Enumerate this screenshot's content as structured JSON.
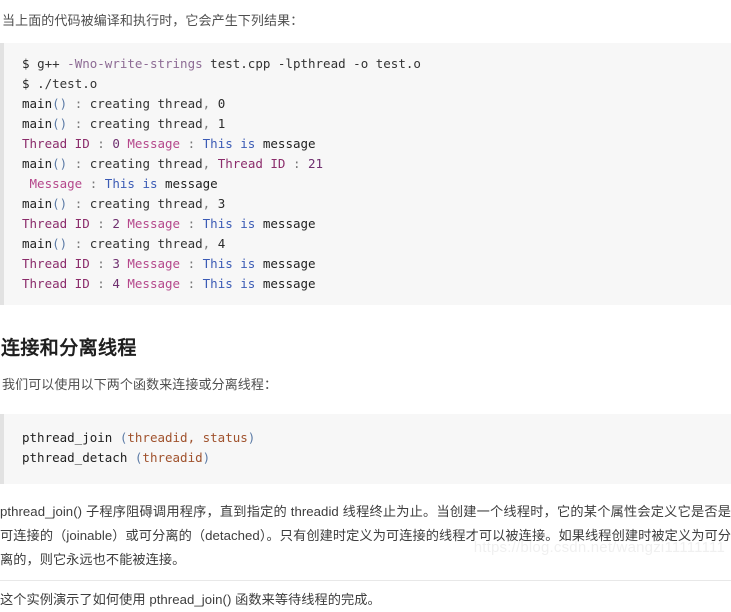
{
  "intro": {
    "paragraph": "当上面的代码被编译和执行时，它会产生下列结果："
  },
  "output_code_block": {
    "lines": [
      {
        "id": "compile",
        "tokens": [
          {
            "text": "$ ",
            "style": "t-dark"
          },
          {
            "text": "g++ ",
            "style": "t-plain"
          },
          {
            "text": "-Wno-write-strings",
            "style": "t-flag"
          },
          {
            "text": " test.cpp ",
            "style": "t-plain"
          },
          {
            "text": "-lpthread",
            "style": "t-plain"
          },
          {
            "text": " -o test.o",
            "style": "t-plain"
          }
        ]
      },
      {
        "id": "run",
        "tokens": [
          {
            "text": "$ ",
            "style": "t-dark"
          },
          {
            "text": "./test.o",
            "style": "t-plain"
          }
        ]
      },
      {
        "id": "main-0",
        "tokens": [
          {
            "text": "main",
            "style": "t-dark"
          },
          {
            "text": "()",
            "style": "t-paren"
          },
          {
            "text": " ",
            "style": "t-plain"
          },
          {
            "text": ":",
            "style": "t-punc"
          },
          {
            "text": " creating thread",
            "style": "t-plain"
          },
          {
            "text": ",",
            "style": "t-punc"
          },
          {
            "text": " 0",
            "style": "t-num"
          }
        ]
      },
      {
        "id": "main-1",
        "tokens": [
          {
            "text": "main",
            "style": "t-dark"
          },
          {
            "text": "()",
            "style": "t-paren"
          },
          {
            "text": " ",
            "style": "t-plain"
          },
          {
            "text": ":",
            "style": "t-punc"
          },
          {
            "text": " creating thread",
            "style": "t-plain"
          },
          {
            "text": ",",
            "style": "t-punc"
          },
          {
            "text": " 1",
            "style": "t-num"
          }
        ]
      },
      {
        "id": "thread-0",
        "tokens": [
          {
            "text": "Thread ID",
            "style": "t-mag"
          },
          {
            "text": " : ",
            "style": "t-punc"
          },
          {
            "text": "0",
            "style": "t-id"
          },
          {
            "text": " ",
            "style": "t-plain"
          },
          {
            "text": "Message",
            "style": "t-pink"
          },
          {
            "text": " : ",
            "style": "t-punc"
          },
          {
            "text": "This",
            "style": "t-blue"
          },
          {
            "text": " ",
            "style": "t-plain"
          },
          {
            "text": "is",
            "style": "t-blue"
          },
          {
            "text": " message",
            "style": "t-dark"
          }
        ]
      },
      {
        "id": "main-thread-21",
        "tokens": [
          {
            "text": "main",
            "style": "t-dark"
          },
          {
            "text": "()",
            "style": "t-paren"
          },
          {
            "text": " ",
            "style": "t-plain"
          },
          {
            "text": ":",
            "style": "t-punc"
          },
          {
            "text": " creating thread",
            "style": "t-plain"
          },
          {
            "text": ",",
            "style": "t-punc"
          },
          {
            "text": " ",
            "style": "t-plain"
          },
          {
            "text": "Thread ID",
            "style": "t-mag"
          },
          {
            "text": " : ",
            "style": "t-punc"
          },
          {
            "text": "21",
            "style": "t-id"
          }
        ]
      },
      {
        "id": "message-only",
        "tokens": [
          {
            "text": " ",
            "style": "t-plain"
          },
          {
            "text": "Message",
            "style": "t-pink"
          },
          {
            "text": " : ",
            "style": "t-punc"
          },
          {
            "text": "This",
            "style": "t-blue"
          },
          {
            "text": " ",
            "style": "t-plain"
          },
          {
            "text": "is",
            "style": "t-blue"
          },
          {
            "text": " message",
            "style": "t-dark"
          }
        ]
      },
      {
        "id": "main-3",
        "tokens": [
          {
            "text": "main",
            "style": "t-dark"
          },
          {
            "text": "()",
            "style": "t-paren"
          },
          {
            "text": " ",
            "style": "t-plain"
          },
          {
            "text": ":",
            "style": "t-punc"
          },
          {
            "text": " creating thread",
            "style": "t-plain"
          },
          {
            "text": ",",
            "style": "t-punc"
          },
          {
            "text": " 3",
            "style": "t-num"
          }
        ]
      },
      {
        "id": "thread-2",
        "tokens": [
          {
            "text": "Thread ID",
            "style": "t-mag"
          },
          {
            "text": " : ",
            "style": "t-punc"
          },
          {
            "text": "2",
            "style": "t-id"
          },
          {
            "text": " ",
            "style": "t-plain"
          },
          {
            "text": "Message",
            "style": "t-pink"
          },
          {
            "text": " : ",
            "style": "t-punc"
          },
          {
            "text": "This",
            "style": "t-blue"
          },
          {
            "text": " ",
            "style": "t-plain"
          },
          {
            "text": "is",
            "style": "t-blue"
          },
          {
            "text": " message",
            "style": "t-dark"
          }
        ]
      },
      {
        "id": "main-4",
        "tokens": [
          {
            "text": "main",
            "style": "t-dark"
          },
          {
            "text": "()",
            "style": "t-paren"
          },
          {
            "text": " ",
            "style": "t-plain"
          },
          {
            "text": ":",
            "style": "t-punc"
          },
          {
            "text": " creating thread",
            "style": "t-plain"
          },
          {
            "text": ",",
            "style": "t-punc"
          },
          {
            "text": " 4",
            "style": "t-num"
          }
        ]
      },
      {
        "id": "thread-3",
        "tokens": [
          {
            "text": "Thread ID",
            "style": "t-mag"
          },
          {
            "text": " : ",
            "style": "t-punc"
          },
          {
            "text": "3",
            "style": "t-id"
          },
          {
            "text": " ",
            "style": "t-plain"
          },
          {
            "text": "Message",
            "style": "t-pink"
          },
          {
            "text": " : ",
            "style": "t-punc"
          },
          {
            "text": "This",
            "style": "t-blue"
          },
          {
            "text": " ",
            "style": "t-plain"
          },
          {
            "text": "is",
            "style": "t-blue"
          },
          {
            "text": " message",
            "style": "t-dark"
          }
        ]
      },
      {
        "id": "thread-4",
        "tokens": [
          {
            "text": "Thread ID",
            "style": "t-mag"
          },
          {
            "text": " : ",
            "style": "t-punc"
          },
          {
            "text": "4",
            "style": "t-id"
          },
          {
            "text": " ",
            "style": "t-plain"
          },
          {
            "text": "Message",
            "style": "t-pink"
          },
          {
            "text": " : ",
            "style": "t-punc"
          },
          {
            "text": "This",
            "style": "t-blue"
          },
          {
            "text": " ",
            "style": "t-plain"
          },
          {
            "text": "is",
            "style": "t-blue"
          },
          {
            "text": " message",
            "style": "t-dark"
          }
        ]
      }
    ]
  },
  "section": {
    "heading": "连接和分离线程",
    "intro": "我们可以使用以下两个函数来连接或分离线程："
  },
  "api_code_block": {
    "lines": [
      {
        "id": "pthread-join",
        "tokens": [
          {
            "text": "pthread_join",
            "style": "t-dark"
          },
          {
            "text": " ",
            "style": "t-plain"
          },
          {
            "text": "(",
            "style": "t-paren"
          },
          {
            "text": "threadid, status",
            "style": "t-arg"
          },
          {
            "text": ")",
            "style": "t-paren"
          }
        ]
      },
      {
        "id": "pthread-detach",
        "tokens": [
          {
            "text": "pthread_detach",
            "style": "t-dark"
          },
          {
            "text": " ",
            "style": "t-plain"
          },
          {
            "text": "(",
            "style": "t-paren"
          },
          {
            "text": "threadid",
            "style": "t-arg"
          },
          {
            "text": ")",
            "style": "t-paren"
          }
        ]
      }
    ]
  },
  "body": {
    "paragraph_1": "pthread_join() 子程序阻碍调用程序，直到指定的 threadid 线程终止为止。当创建一个线程时，它的某个属性会定义它是否是可连接的（joinable）或可分离的（detached）。只有创建时定义为可连接的线程才可以被连接。如果线程创建时被定义为可分离的，则它永远也不能被连接。",
    "paragraph_2": "这个实例演示了如何使用 pthread_join() 函数来等待线程的完成。"
  },
  "watermark": {
    "text": "https://blog.csdn.net/wangzi11111111"
  },
  "colors": {
    "code_background": "#f7f7f7",
    "code_border": "#e2e2e2",
    "heading": "#1f1f1f",
    "body_text": "#3d3d3d",
    "watermark": "#f0f0f0"
  }
}
